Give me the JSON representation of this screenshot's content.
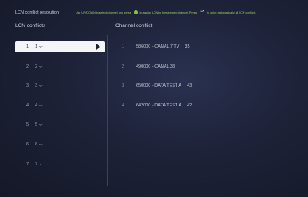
{
  "header": {
    "title": "LCN conflict resolution",
    "hint_part1": "Use UP/DOWN to select channel and press",
    "hint_part2": "to assign LCN to the selected channel. Press",
    "hint_part3": "to solve automatically all LCN conflicts",
    "ok_icon": "ok-button-icon",
    "return_icon": "return-arrow-icon",
    "return_glyph": "↩"
  },
  "left_panel": {
    "heading": "LCN conflicts",
    "items": [
      {
        "number": "1",
        "label": "1 -/-",
        "selected": true
      },
      {
        "number": "2",
        "label": "2 -/-"
      },
      {
        "number": "3",
        "label": "3 -/-"
      },
      {
        "number": "4",
        "label": "4 -/-"
      },
      {
        "number": "5",
        "label": "5 -/-"
      },
      {
        "number": "6",
        "label": "6 -/-"
      },
      {
        "number": "7",
        "label": "7 -/-"
      }
    ]
  },
  "right_panel": {
    "heading": "Channel conflict",
    "channels": [
      {
        "index": "1",
        "name": "586000 - CANAL 7 TV",
        "lcn": "35"
      },
      {
        "index": "2",
        "name": "490000 - CANAL 33",
        "lcn": ""
      },
      {
        "index": "3",
        "name": "650000 - DATA TEST A",
        "lcn": "43"
      },
      {
        "index": "4",
        "name": "642000 - DATA TEST A",
        "lcn": "42"
      }
    ]
  },
  "colors": {
    "background": "#1b2033",
    "selected_bg": "#f4f5f7",
    "ok_green": "#86c63f",
    "hint_text": "#9fd06b"
  }
}
